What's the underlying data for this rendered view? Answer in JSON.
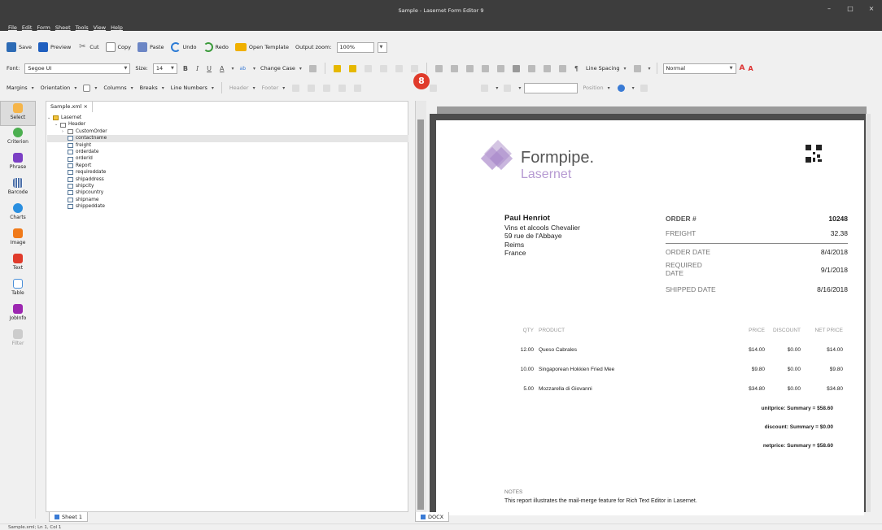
{
  "window": {
    "title": "Sample - Lasernet Form Editor 9",
    "minimize": "–",
    "maximize": "□",
    "close": "×"
  },
  "menu": [
    "File",
    "Edit",
    "Form",
    "Sheet",
    "Tools",
    "View",
    "Help"
  ],
  "toolbar1": {
    "save": "Save",
    "preview": "Preview",
    "cut": "Cut",
    "copy": "Copy",
    "paste": "Paste",
    "undo": "Undo",
    "redo": "Redo",
    "open_template": "Open Template",
    "output_zoom_label": "Output zoom:",
    "output_zoom_value": "100%"
  },
  "toolbar2": {
    "font_label": "Font:",
    "font_value": "Segoe UI",
    "size_label": "Size:",
    "size_value": "14",
    "bold": "B",
    "italic": "I",
    "underline": "U",
    "font_color": "A",
    "highlight": "ab",
    "change_case": "Change Case",
    "line_spacing": "Line Spacing",
    "pilcrow": "¶",
    "style_value": "Normal"
  },
  "toolbar3": {
    "margins": "Margins",
    "orientation": "Orientation",
    "columns": "Columns",
    "breaks": "Breaks",
    "line_numbers": "Line Numbers",
    "header": "Header",
    "footer": "Footer",
    "position": "Position"
  },
  "badge": "8",
  "leftbar": [
    "Select",
    "Criterion",
    "Phrase",
    "Barcode",
    "Charts",
    "Image",
    "Text",
    "Table",
    "JobInfo",
    "Filter"
  ],
  "tree_tab": "Sample.xml",
  "tree_tab_close": "×",
  "tree": [
    {
      "label": "Lasernet",
      "indent": 0,
      "caret": "⌄",
      "root": true
    },
    {
      "label": "Header",
      "indent": 1,
      "caret": "⌄"
    },
    {
      "label": "CustomOrder",
      "indent": 2,
      "caret": "›"
    },
    {
      "label": "contactname",
      "indent": 2,
      "hl": true
    },
    {
      "label": "freight",
      "indent": 2
    },
    {
      "label": "orderdate",
      "indent": 2
    },
    {
      "label": "orderid",
      "indent": 2
    },
    {
      "label": "Report",
      "indent": 2
    },
    {
      "label": "requireddate",
      "indent": 2
    },
    {
      "label": "shipaddress",
      "indent": 2
    },
    {
      "label": "shipcity",
      "indent": 2
    },
    {
      "label": "shipcountry",
      "indent": 2
    },
    {
      "label": "shipname",
      "indent": 2
    },
    {
      "label": "shippeddate",
      "indent": 2
    }
  ],
  "document": {
    "brand_top": "Formpipe.",
    "brand_bottom": "Lasernet",
    "address": [
      "Paul Henriot",
      "Vins et alcools Chevalier",
      "59 rue de l'Abbaye",
      "Reims",
      "France"
    ],
    "order_no_label": "ORDER #",
    "order_no": "10248",
    "freight_label": "FREIGHT",
    "freight": "32.38",
    "order_date_label": "ORDER DATE",
    "order_date": "8/4/2018",
    "required_label_1": "REQUIRED",
    "required_label_2": "DATE",
    "required_date": "9/1/2018",
    "shipped_label": "SHIPPED DATE",
    "shipped_date": "8/16/2018",
    "col_qty": "QTY",
    "col_product": "PRODUCT",
    "col_price": "PRICE",
    "col_discount": "DISCOUNT",
    "col_net": "NET PRICE",
    "items": [
      {
        "qty": "12.00",
        "product": "Queso Cabrales",
        "price": "$14.00",
        "discount": "$0.00",
        "net": "$14.00"
      },
      {
        "qty": "10.00",
        "product": "Singaporean Hokkien Fried Mee",
        "price": "$9.80",
        "discount": "$0.00",
        "net": "$9.80"
      },
      {
        "qty": "5.00",
        "product": "Mozzarella di Giovanni",
        "price": "$34.80",
        "discount": "$0.00",
        "net": "$34.80"
      }
    ],
    "summary_unit": "unitprice: Summary = $58.60",
    "summary_discount": "discount: Summary = $0.00",
    "summary_net": "netprice: Summary = $58.60",
    "notes_label": "NOTES",
    "notes_text": "This report illustrates the mail-merge feature for Rich Text Editor in Lasernet."
  },
  "tabs": {
    "sheet": "Sheet 1",
    "docx": "DOCX"
  },
  "status": "Sample.xml; Ln 1, Col 1"
}
